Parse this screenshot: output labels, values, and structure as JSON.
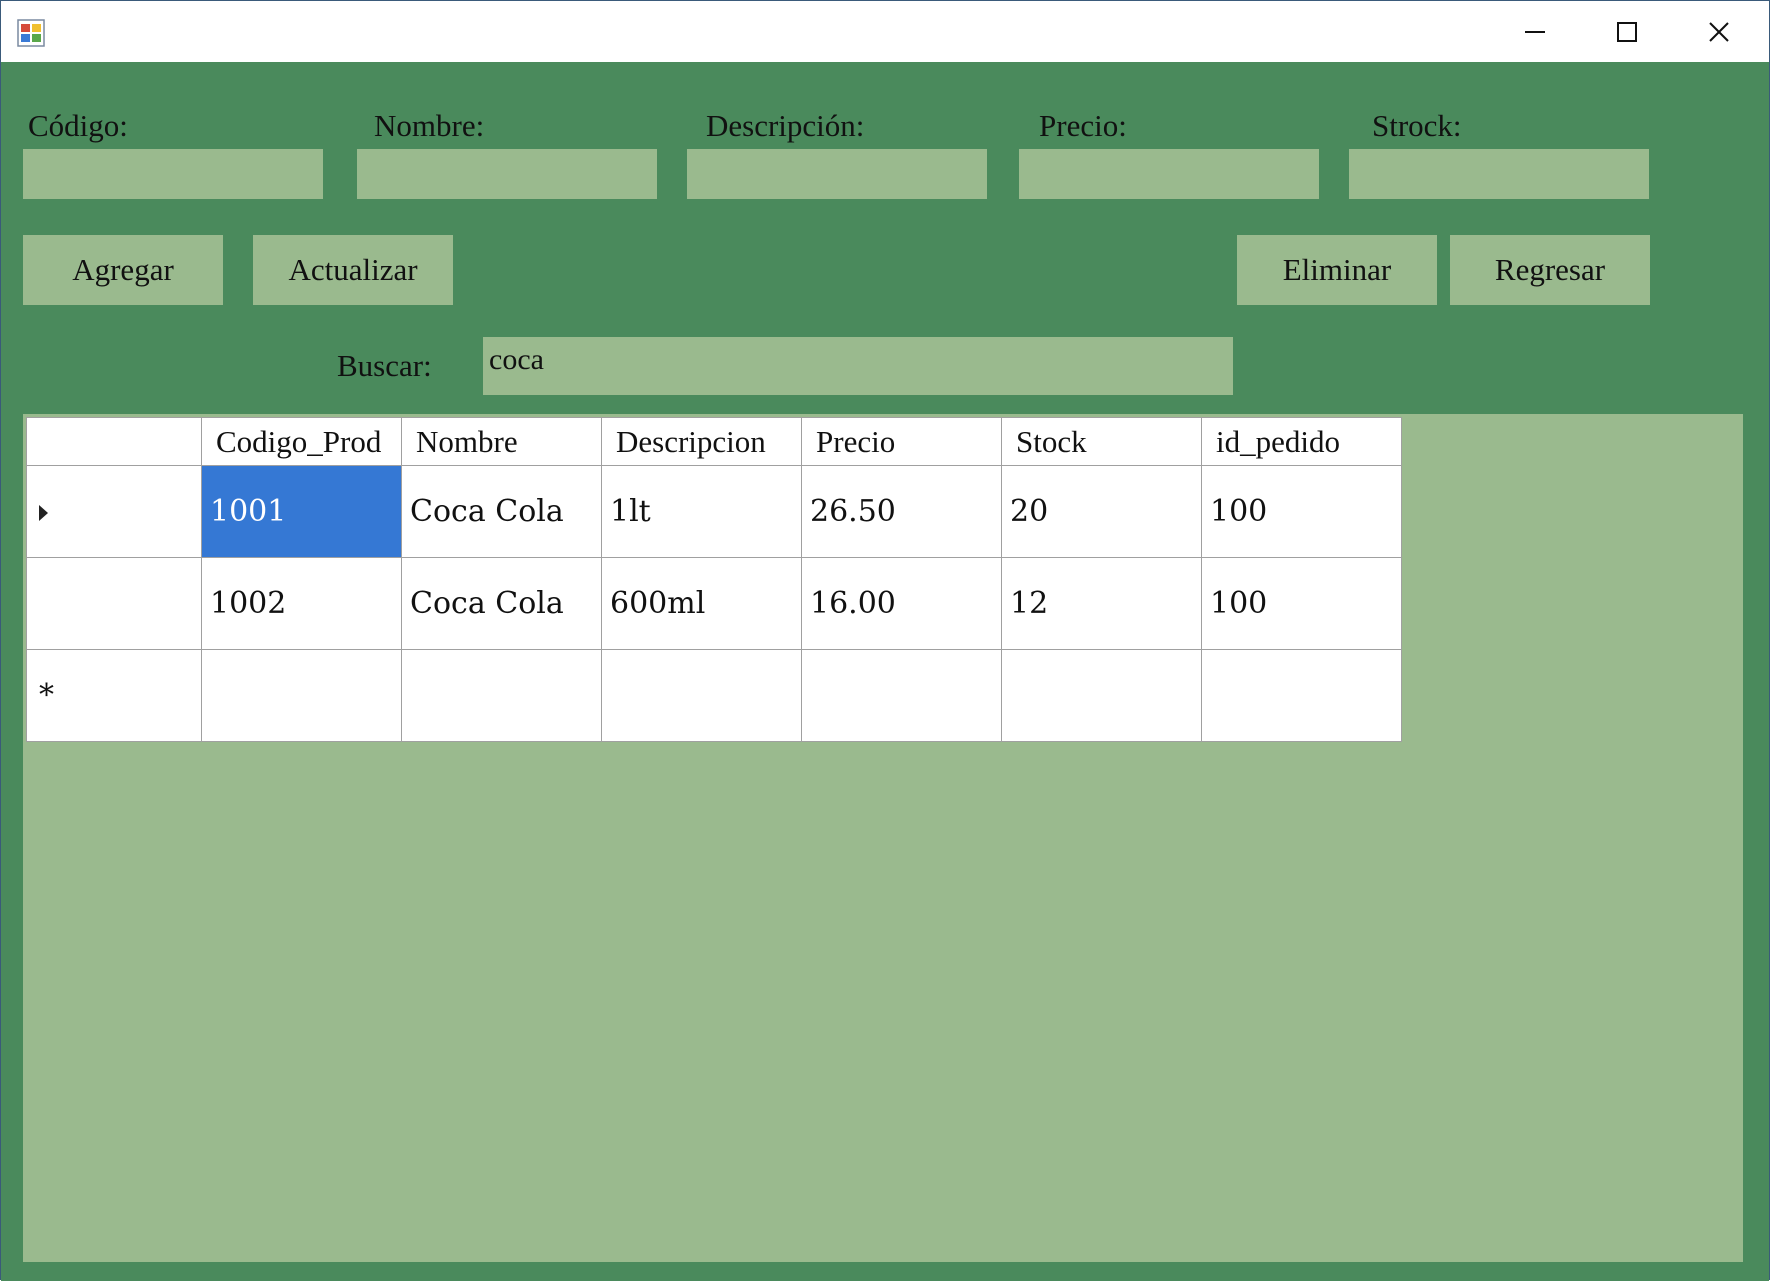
{
  "window": {
    "title": "",
    "controls": {
      "minimize": "minimize-icon",
      "maximize": "maximize-icon",
      "close": "close-icon"
    }
  },
  "form": {
    "fields": [
      {
        "label": "Código:",
        "value": ""
      },
      {
        "label": "Nombre:",
        "value": ""
      },
      {
        "label": "Descripción:",
        "value": ""
      },
      {
        "label": "Precio:",
        "value": ""
      },
      {
        "label": "Strock:",
        "value": ""
      }
    ],
    "buttons": {
      "add": "Agregar",
      "update": "Actualizar",
      "delete": "Eliminar",
      "back": "Regresar"
    },
    "search": {
      "label": "Buscar:",
      "value": "coca"
    }
  },
  "grid": {
    "columns": [
      "Codigo_Prod",
      "Nombre",
      "Descripcion",
      "Precio",
      "Stock",
      "id_pedido"
    ],
    "rows": [
      [
        "1001",
        "Coca Cola",
        "1lt",
        "26.50",
        "20",
        "100"
      ],
      [
        "1002",
        "Coca Cola",
        "600ml",
        "16.00",
        "12",
        "100"
      ]
    ],
    "new_row_marker": "*"
  },
  "colors": {
    "form_background": "#4a8a5c",
    "control_fill": "#9aba8e",
    "selection": "#3578d4"
  }
}
